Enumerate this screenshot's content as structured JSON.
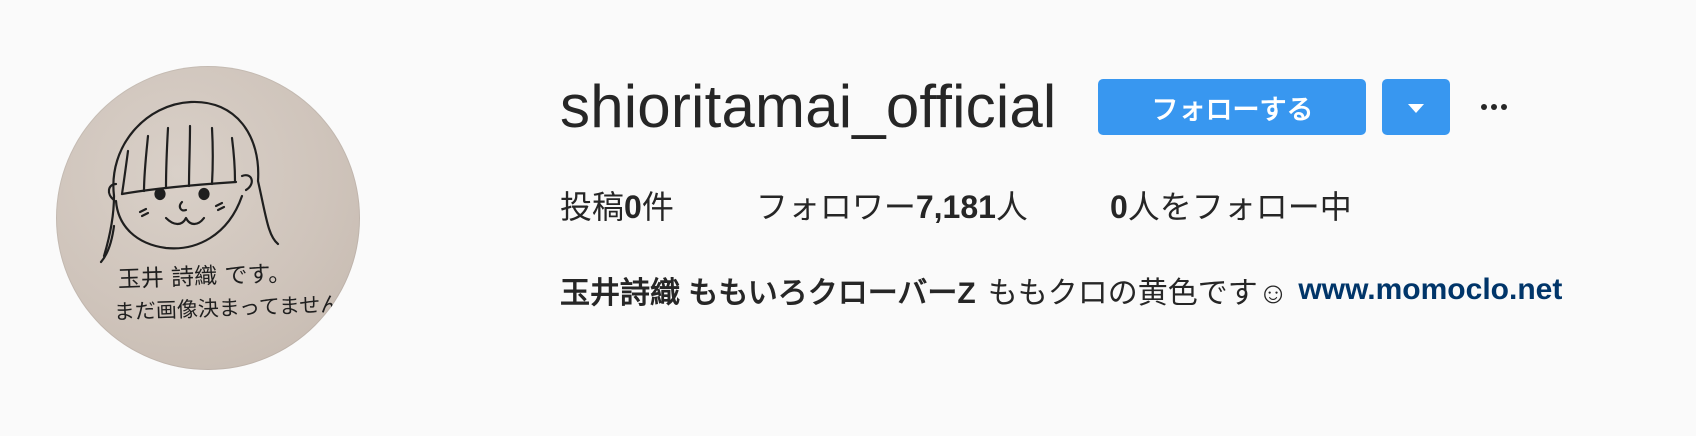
{
  "profile": {
    "username": "shioritamai_official",
    "follow_label": "フォローする",
    "avatar_caption_line1": "玉井 詩織 です。",
    "avatar_caption_line2": "まだ画像決まってません。",
    "stats": {
      "posts_prefix": "投稿",
      "posts_count": "0",
      "posts_suffix": "件",
      "followers_prefix": "フォロワー",
      "followers_count": "7,181",
      "followers_suffix": "人",
      "following_count": "0",
      "following_suffix": "人をフォロー中"
    },
    "bio": {
      "full_name": "玉井詩織 ももいろクローバーZ",
      "text": "ももクロの黄色です☺",
      "link": "www.momoclo.net"
    }
  },
  "icons": {
    "dropdown": "chevron-down-icon",
    "more": "more-horizontal-icon"
  },
  "colors": {
    "accent": "#3897f0",
    "link": "#003569",
    "text": "#262626",
    "background": "#fafafa"
  }
}
